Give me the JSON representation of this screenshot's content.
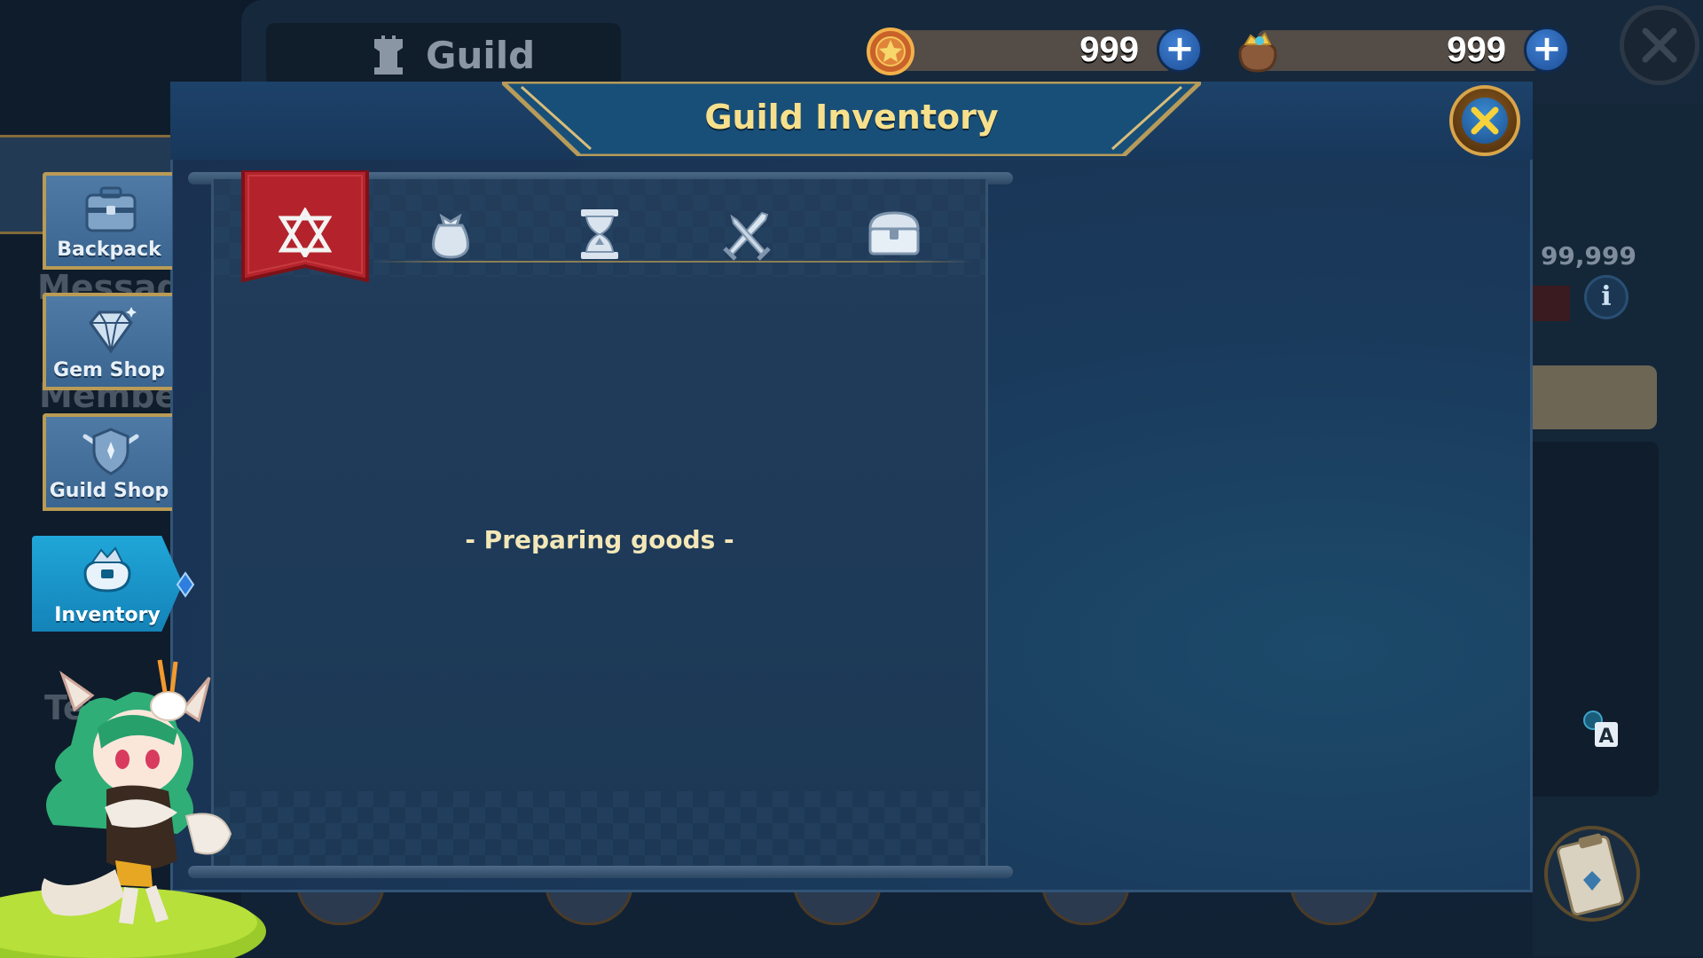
{
  "background": {
    "title": "Guild",
    "right_value": ": 99,999",
    "ghost_labels": [
      "Message",
      "Member",
      "Ter"
    ]
  },
  "currencies": [
    {
      "name": "guild-coin",
      "value": "999"
    },
    {
      "name": "treasure-bag",
      "value": "999"
    }
  ],
  "side_menu": [
    {
      "label": "Backpack",
      "icon": "backpack-icon"
    },
    {
      "label": "Gem Shop",
      "icon": "gem-icon"
    },
    {
      "label": "Guild Shop",
      "icon": "guild-shield-icon"
    },
    {
      "label": "Inventory",
      "icon": "inventory-icon",
      "active": true
    }
  ],
  "modal": {
    "title": "Guild Inventory",
    "tabs": [
      {
        "icon": "star-emblem-icon",
        "active": true
      },
      {
        "icon": "pouch-icon"
      },
      {
        "icon": "hourglass-icon"
      },
      {
        "icon": "crossed-swords-icon"
      },
      {
        "icon": "chest-icon"
      }
    ],
    "empty_message": "- Preparing goods -"
  },
  "colors": {
    "title_gold": "#f7e08c",
    "active_tab_red": "#b4232c",
    "menu_blue": "#1a9cd2",
    "frame_gold": "#b99b56"
  }
}
